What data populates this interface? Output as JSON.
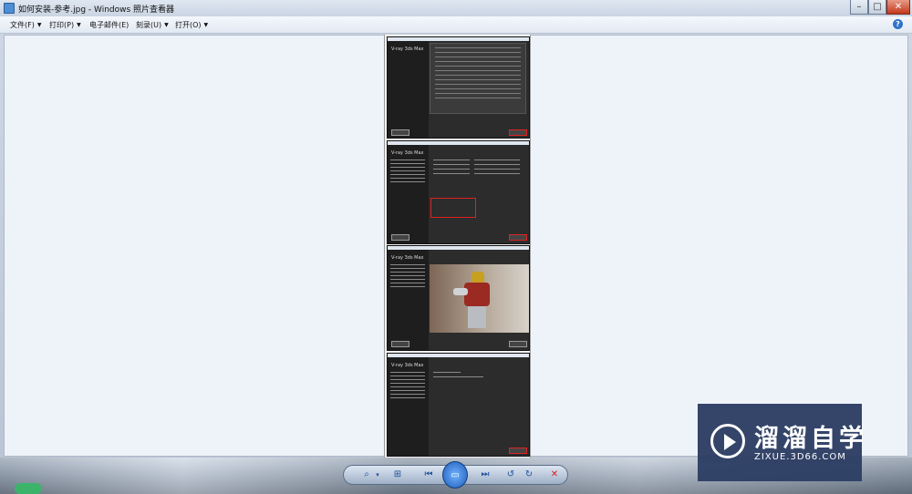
{
  "window": {
    "title": "如何安装-参考.jpg - Windows 照片查看器",
    "min_glyph": "–",
    "max_glyph": "□",
    "close_glyph": "✕"
  },
  "menubar": {
    "items": [
      {
        "label": "文件(F)",
        "has_dropdown": true
      },
      {
        "label": "打印(P)",
        "has_dropdown": true
      },
      {
        "label": "电子邮件(E)",
        "has_dropdown": false
      },
      {
        "label": "刻录(U)",
        "has_dropdown": true
      },
      {
        "label": "打开(O)",
        "has_dropdown": true
      }
    ],
    "help_glyph": "?"
  },
  "photo": {
    "shots": [
      {
        "brand": "V-ray 3ds Max"
      },
      {
        "brand": "V-ray 3ds Max"
      },
      {
        "brand": "V-ray 3ds Max"
      },
      {
        "brand": "V-ray 3ds Max"
      }
    ]
  },
  "navigation": {
    "zoom_glyph": "⌕",
    "zoom_arrow": "▾",
    "fit_glyph": "⊞",
    "prev_glyph": "⏮",
    "slideshow_glyph": "▭",
    "next_glyph": "⏭",
    "rotate_ccw_glyph": "↺",
    "rotate_cw_glyph": "↻",
    "delete_glyph": "✕"
  },
  "watermark": {
    "name_cn": "溜溜自学",
    "name_en": "ZIXUE.3D66.COM"
  },
  "colors": {
    "accent": "#1d5bb8",
    "delete": "#d21e1e",
    "watermark_bg": "#2d3e64",
    "highlight_box": "#dd2222"
  }
}
